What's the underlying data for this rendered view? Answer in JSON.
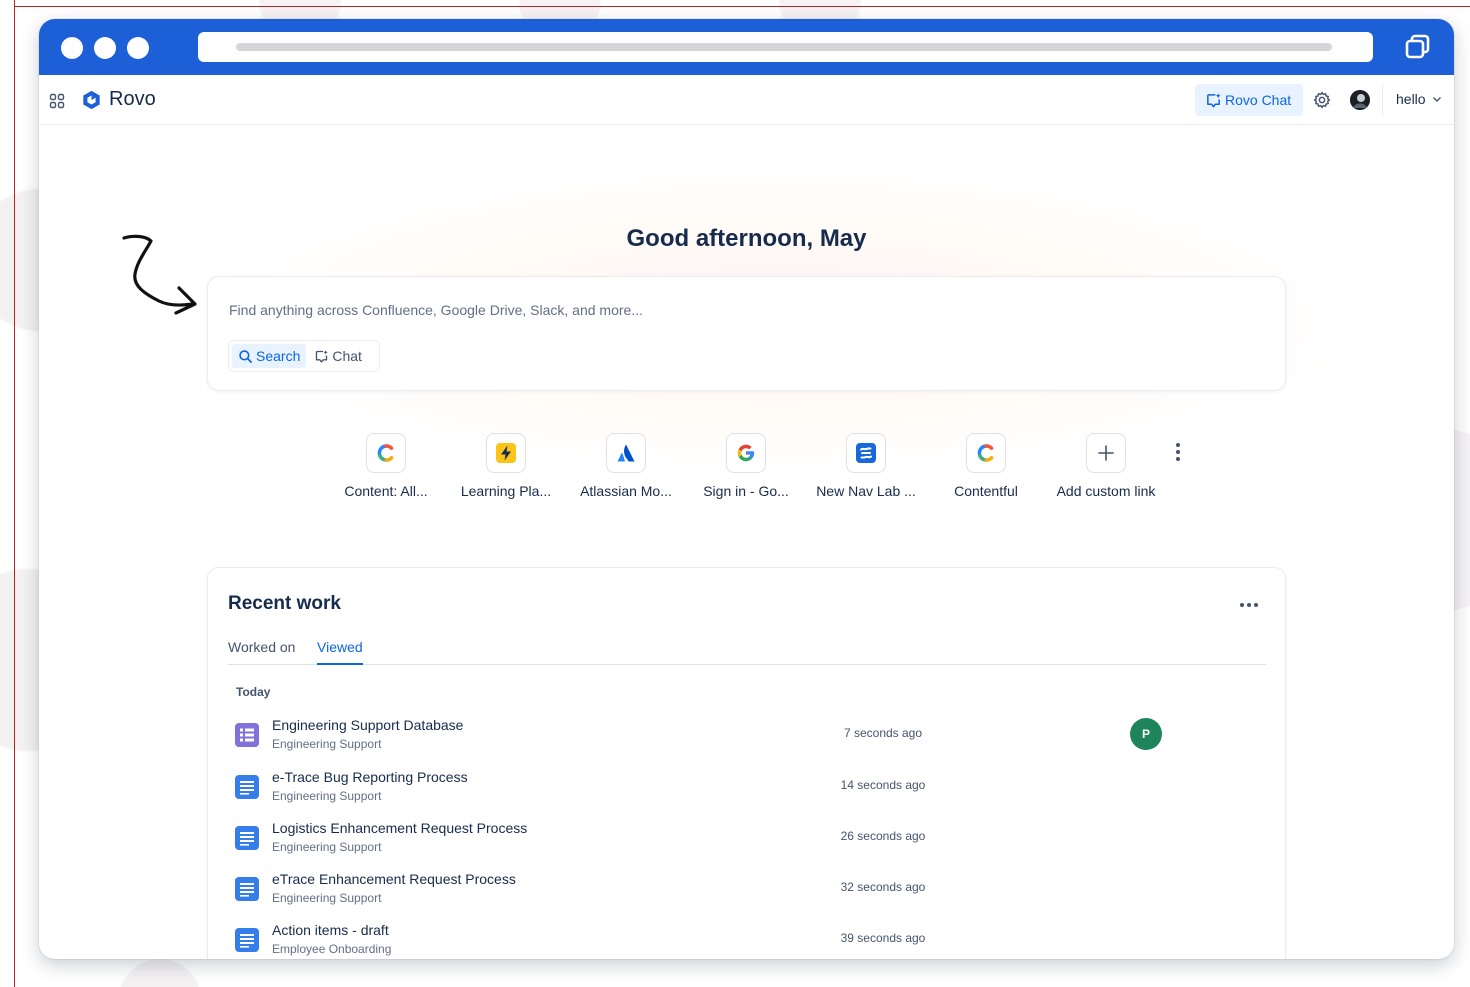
{
  "app": {
    "brand": "Rovo",
    "rovo_chat_label": "Rovo Chat",
    "user_label": "hello"
  },
  "hero": {
    "greeting": "Good afternoon, May",
    "search_placeholder": "Find anything across Confluence, Google Drive, Slack, and more...",
    "search_mode_label": "Search",
    "chat_mode_label": "Chat"
  },
  "shortcuts": [
    {
      "label": "Content: All...",
      "icon": "confluence-icon"
    },
    {
      "label": "Learning Pla...",
      "icon": "lightning-icon"
    },
    {
      "label": "Atlassian Mo...",
      "icon": "atlassian-icon"
    },
    {
      "label": "Sign in - Go...",
      "icon": "google-icon"
    },
    {
      "label": "New Nav Lab ...",
      "icon": "nav-lab-icon"
    },
    {
      "label": "Contentful",
      "icon": "confluence-icon"
    },
    {
      "label": "Add custom link",
      "icon": "plus-icon"
    }
  ],
  "recent": {
    "title": "Recent work",
    "tabs": [
      "Worked on",
      "Viewed"
    ],
    "active_tab": "Viewed",
    "section": "Today",
    "items": [
      {
        "title": "Engineering Support Database",
        "space": "Engineering Support",
        "time": "7 seconds ago",
        "icon": "database-icon",
        "avatar": "P"
      },
      {
        "title": "e-Trace Bug Reporting Process",
        "space": "Engineering Support",
        "time": "14 seconds ago",
        "icon": "page-icon"
      },
      {
        "title": "Logistics Enhancement Request Process",
        "space": "Engineering Support",
        "time": "26 seconds ago",
        "icon": "page-icon"
      },
      {
        "title": "eTrace Enhancement Request Process",
        "space": "Engineering Support",
        "time": "32 seconds ago",
        "icon": "page-icon"
      },
      {
        "title": "Action items - draft",
        "space": "Employee Onboarding",
        "time": "39 seconds ago",
        "icon": "page-icon"
      }
    ]
  },
  "colors": {
    "titlebar": "#1d5fd6",
    "accent": "#0c66e4",
    "accent_bg": "#e9f2ff",
    "avatar_green": "#1f845a",
    "database_purple": "#8270db",
    "page_blue": "#357de8"
  }
}
